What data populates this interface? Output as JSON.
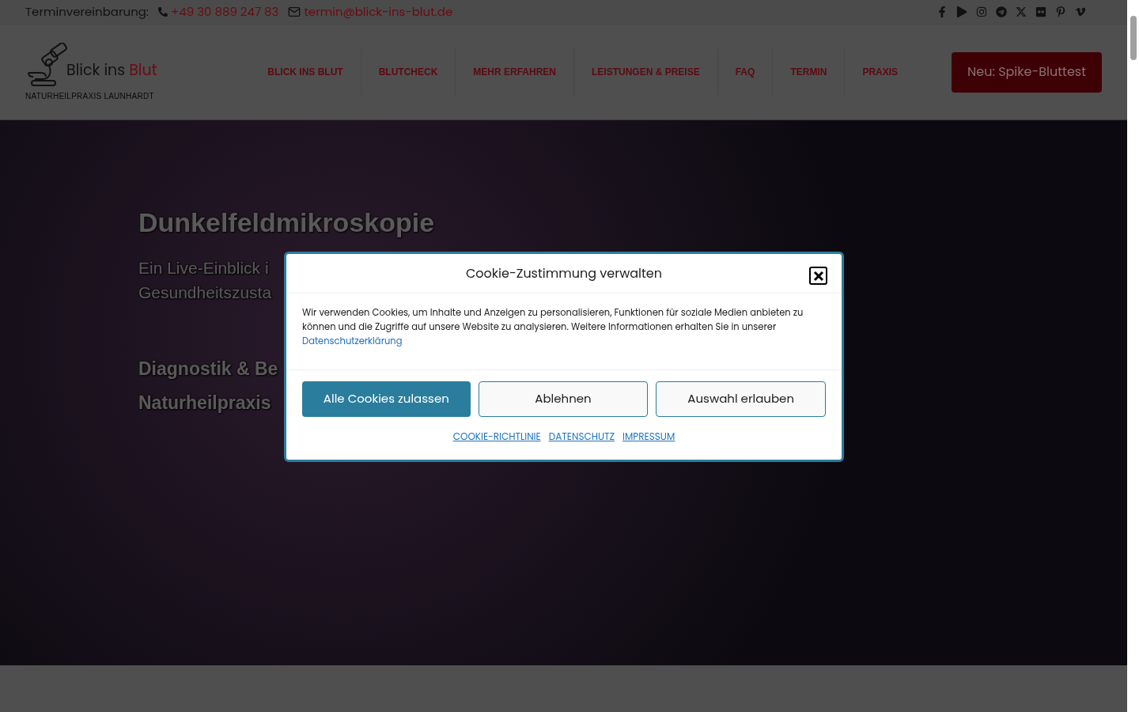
{
  "top_bar": {
    "label": "Terminvereinbarung:",
    "phone": "+49 30 889 247 83",
    "email": "termin@blick-ins-blut.de"
  },
  "header": {
    "logo": {
      "name": "Blick ins",
      "name_accent": "Blut",
      "tagline": "NATURHEILPRAXIS LAUNHARDT"
    },
    "nav": [
      {
        "label": "BLICK INS BLUT"
      },
      {
        "label": "BLUTCHECK"
      },
      {
        "label": "MEHR ERFAHREN"
      },
      {
        "label": "LEISTUNGEN & PREISE"
      },
      {
        "label": "FAQ"
      },
      {
        "label": "TERMIN"
      },
      {
        "label": "PRAXIS"
      }
    ],
    "cta": "Neu: Spike-Bluttest"
  },
  "hero": {
    "title": "Dunkelfeldmikroskopie",
    "subtitle_lines": [
      "Ein Live-Einblick i",
      "Gesundheitszusta"
    ],
    "tagline_lines": [
      "Diagnostik & Be",
      "Naturheilpraxis"
    ]
  },
  "cookie_dialog": {
    "title": "Cookie-Zustimmung verwalten",
    "text": "Wir verwenden Cookies, um Inhalte und Anzeigen zu personalisieren, Funktionen für soziale Medien anbieten zu können und die Zugriffe auf unsere Website zu analysieren. Weitere Informationen erhalten Sie in unserer",
    "text_link": "Datenschutzerklärung",
    "buttons": [
      {
        "label": "Alle Cookies zulassen",
        "kind": "primary"
      },
      {
        "label": "Ablehnen",
        "kind": "secondary"
      },
      {
        "label": "Auswahl erlauben",
        "kind": "secondary"
      }
    ],
    "links": [
      "COOKIE-RICHTLINIE",
      "DATENSCHUTZ",
      "IMPRESSUM"
    ]
  }
}
